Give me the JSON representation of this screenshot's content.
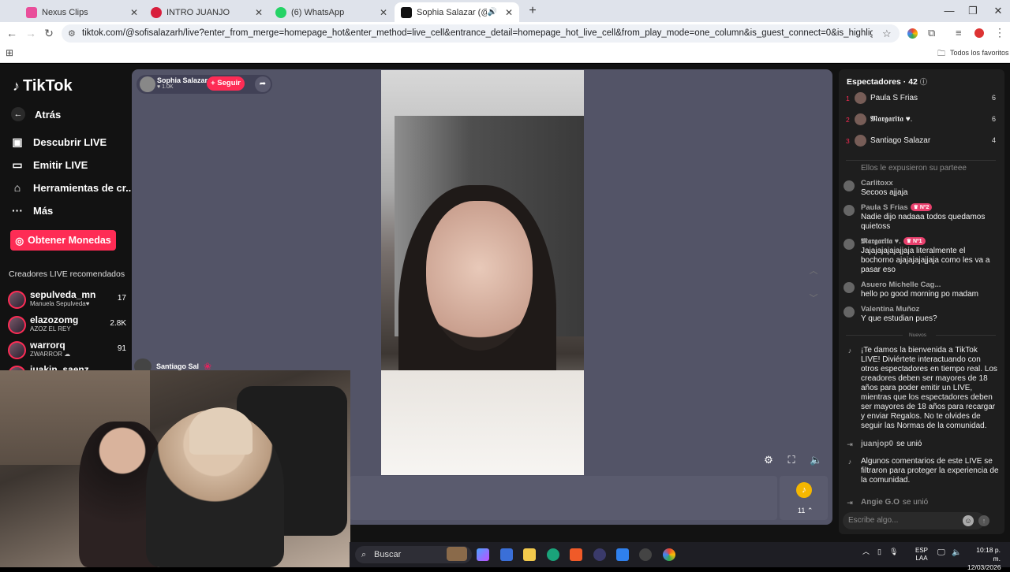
{
  "browser": {
    "tabs": [
      {
        "title": "Nexus Clips",
        "color": "#e94e9a"
      },
      {
        "title": "INTRO JUANJO",
        "color": "#d81e3c"
      },
      {
        "title": "(6) WhatsApp",
        "color": "#25d366"
      },
      {
        "title": "Sophia Salazar (@sofisalaz...",
        "color": "#111111"
      }
    ],
    "new_tab": "+",
    "url": "tiktok.com/@sofisalazarh/live?enter_from_merge=homepage_hot&enter_method=live_cell&entrance_detail=homepage_hot_live_cell&from_play_mode=one_column&is_guest_connect=0&is_highlight=0&is_landscape=0&request_id=2026031...",
    "bookmarks_folder": "Todos los favoritos"
  },
  "sidebar": {
    "logo": "TikTok",
    "back": "Atrás",
    "items": [
      {
        "label": "Descubrir LIVE",
        "icon": "calendar-icon"
      },
      {
        "label": "Emitir LIVE",
        "icon": "video-icon"
      },
      {
        "label": "Herramientas de cr...",
        "icon": "home-tools-icon"
      },
      {
        "label": "Más",
        "icon": "more-icon"
      }
    ],
    "coins_button": "Obtener Monedas",
    "recommended_title": "Creadores LIVE recomendados",
    "recommended": [
      {
        "name": "sepulveda_mn",
        "sub": "Manuela Sepulveda♥",
        "count": "17"
      },
      {
        "name": "elazozomg",
        "sub": "AZOZ EL REY",
        "count": "2.8K"
      },
      {
        "name": "warrorq",
        "sub": "ZWARROR ☁",
        "count": "91"
      },
      {
        "name": "juakin_saenz",
        "sub": "",
        "count": ""
      }
    ]
  },
  "host": {
    "name": "Sophia Salazar",
    "likes": "♥ 1.0K",
    "follow": "+ Seguir"
  },
  "overlay_user": "Santiago Sal",
  "gift_count": "11 ⌃",
  "viewers": {
    "title": "Espectadores · 42",
    "top": [
      {
        "rank": "1",
        "name": "Paula S Frias",
        "score": "6"
      },
      {
        "rank": "2",
        "name": "𝕸𝖆𝖗𝖌𝖆𝖗𝖎𝖙𝖆 ♥.",
        "score": "6"
      },
      {
        "rank": "3",
        "name": "Santiago Salazar",
        "score": "4"
      }
    ]
  },
  "chat": {
    "partial": "Ellos le expusieron su parteee",
    "comments": [
      {
        "user": "Carlitoxx",
        "badge": "",
        "msg": "Secoos ajjaja"
      },
      {
        "user": "Paula S Frias",
        "badge": "♛ Nº2",
        "msg": "Nadie dijo nadaaa todos quedamos quietoss"
      },
      {
        "user": "𝕸𝖆𝖗𝖌𝖆𝖗𝖎𝖙𝖆 ♥.",
        "badge": "♛ Nº1",
        "msg": "Jajajajajajajjaja literalmente el bochorno ajajajajajjaja como les va a pasar eso"
      },
      {
        "user": "Asuero Michelle Cag...",
        "badge": "",
        "msg": "hello po good morning po madam"
      },
      {
        "user": "Valentina Muñoz",
        "badge": "",
        "msg": "Y que estudian pues?"
      }
    ],
    "new_label": "Nuevos",
    "welcome": "¡Te damos la bienvenida a TikTok LIVE! Diviértete interactuando con otros espectadores en tiempo real. Los creadores deben ser mayores de 18 años para poder emitir un LIVE, mientras que los espectadores deben ser mayores de 18 años para recargar y enviar Regalos. No te olvides de seguir las Normas de la comunidad.",
    "join1_user": "juanjop0",
    "join1_text": "se unió",
    "filtered": "Algunos comentarios de este LIVE se filtraron para proteger la experiencia de la comunidad.",
    "join2_user": "Angie G.O",
    "join2_text": "se unió",
    "input_placeholder": "Escribe algo..."
  },
  "taskbar": {
    "search": "Buscar",
    "lang1": "ESP",
    "lang2": "LAA",
    "time": "10:18 p. m.",
    "date": "12/03/2026"
  }
}
